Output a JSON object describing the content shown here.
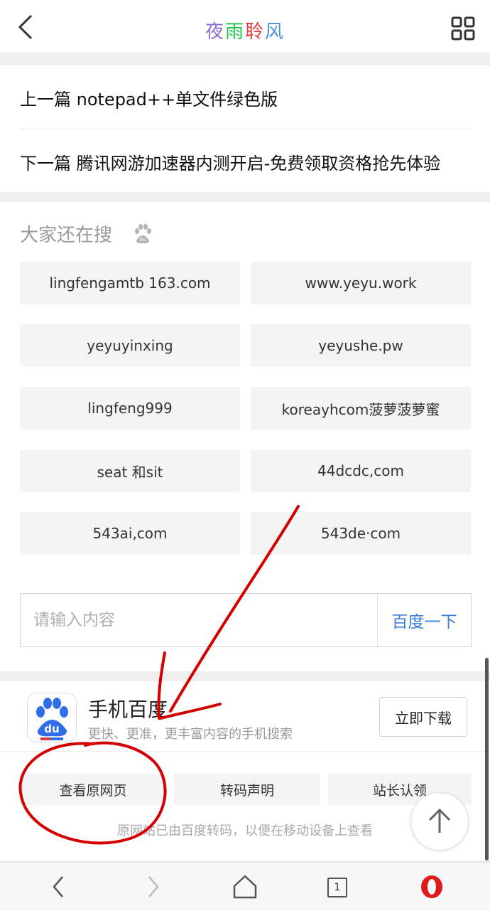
{
  "header": {
    "title": "夜雨聆风",
    "title_colors": [
      "#8b6fd6",
      "#21c44b",
      "#e23a3a",
      "#4a90e2"
    ]
  },
  "nav": {
    "prev_label": "上一篇 notepad++单文件绿色版",
    "next_label": "下一篇 腾讯网游加速器内测开启-免费领取资格抢先体验"
  },
  "search": {
    "heading": "大家还在搜",
    "chips": [
      "lingfengamtb 163.com",
      "www.yeyu.work",
      "yeyuyinxing",
      "yeyushe.pw",
      "lingfeng999",
      "koreayhcom菠萝菠萝蜜",
      "seat 和sit",
      "44dcdc,com",
      "543ai,com",
      "543de·com"
    ],
    "placeholder": "请输入内容",
    "button_label": "百度一下"
  },
  "app_banner": {
    "name": "手机百度",
    "description": "更快、更准，更丰富内容的手机搜索",
    "icon_text": "du",
    "download_label": "立即下载",
    "buttons": [
      "查看原网页",
      "转码声明",
      "站长认领"
    ],
    "footnote": "原网站已由百度转码，以便在移动设备上查看"
  },
  "browser_bar": {
    "tab_count": "1",
    "icons": [
      "back-icon",
      "forward-icon",
      "home-icon",
      "tabs-icon",
      "opera-icon"
    ]
  },
  "colors": {
    "accent_blue": "#3a7fd8",
    "baidu_blue": "#2f6ee6",
    "annotation_red": "#d40000",
    "opera_red": "#e01a1a"
  }
}
